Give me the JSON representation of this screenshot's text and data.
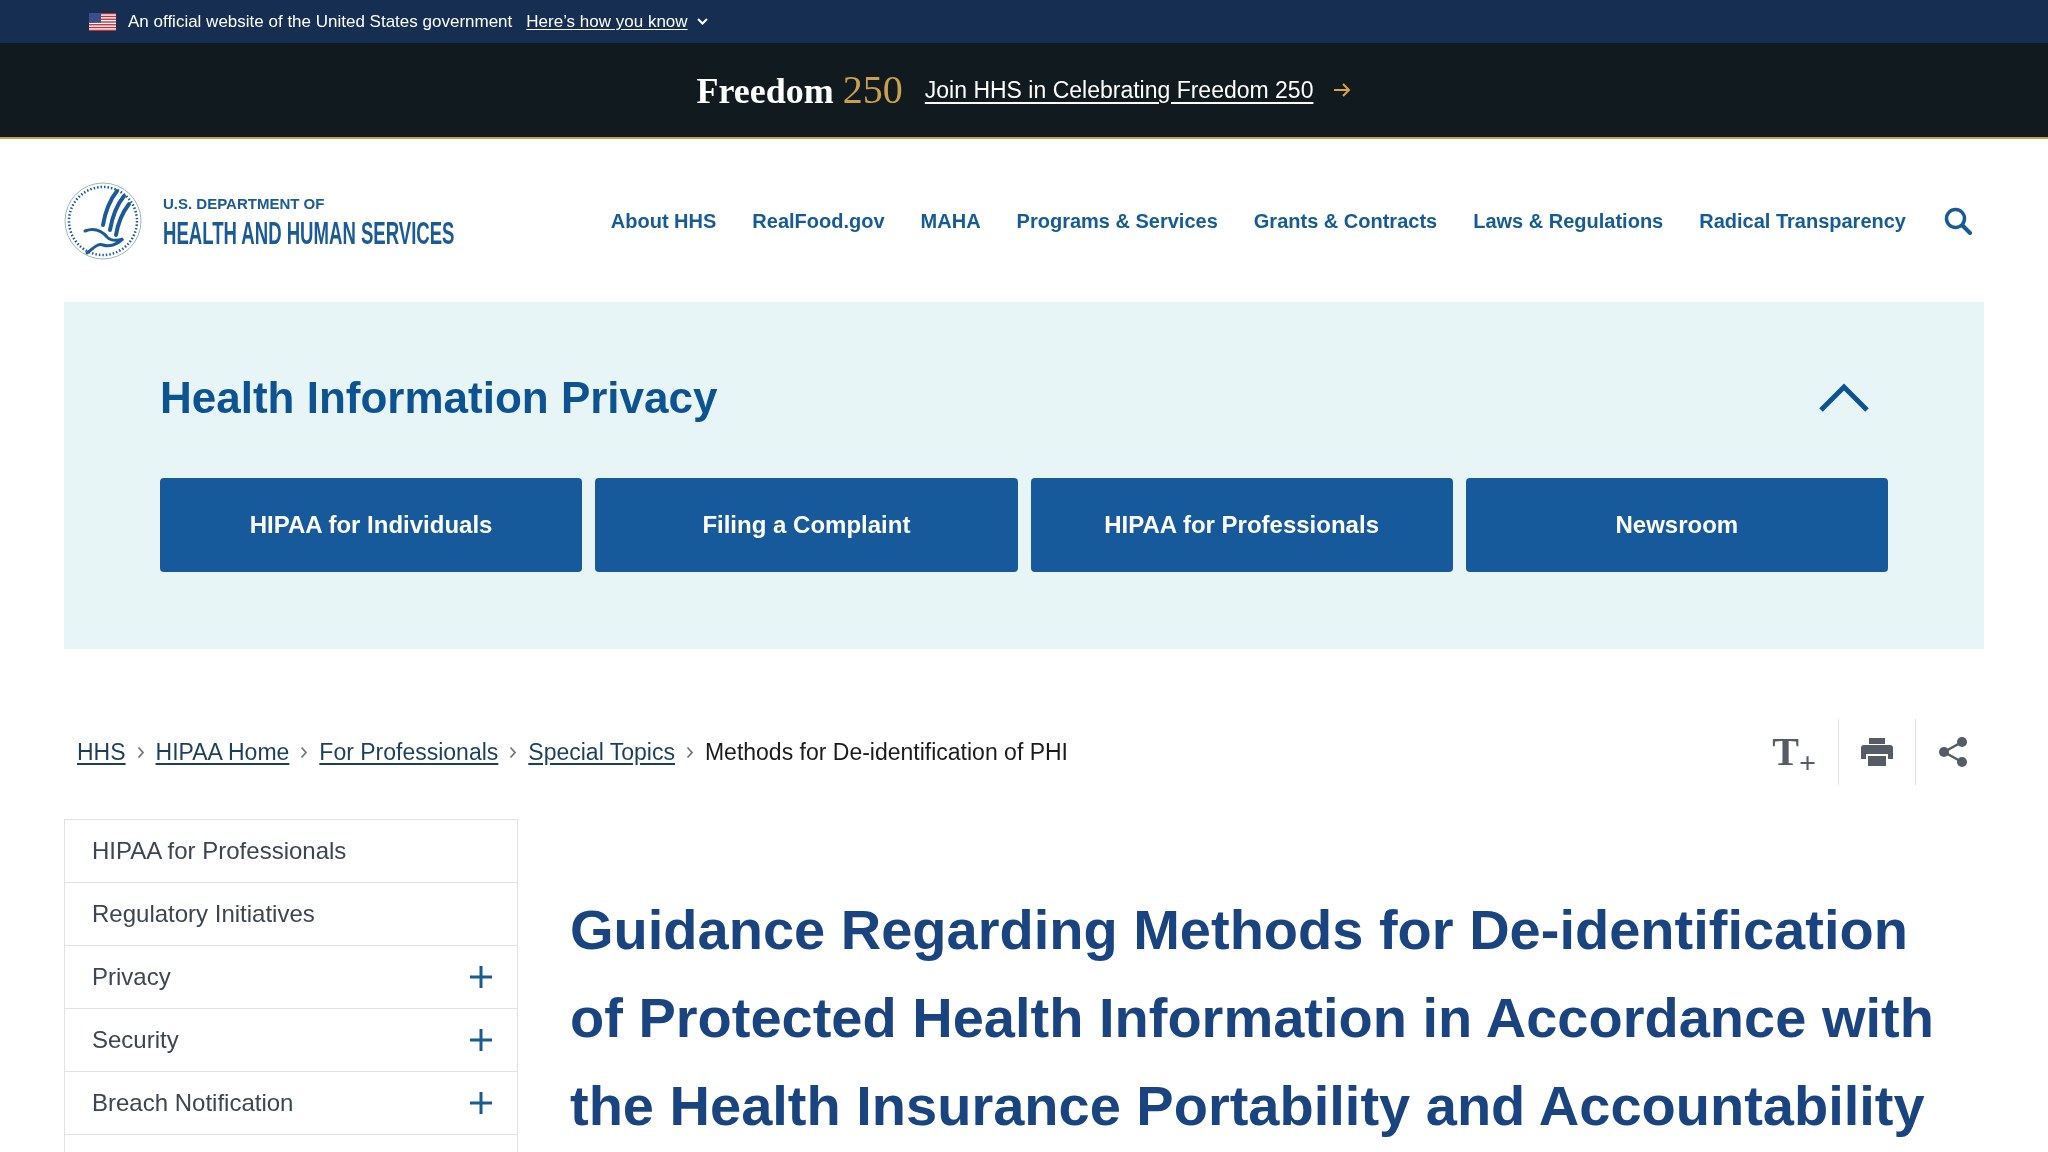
{
  "gov_banner": {
    "text": "An official website of the United States government",
    "link": "Here’s how you know",
    "expanded": false
  },
  "promo_bar": {
    "logo_word": "Freedom",
    "logo_number": "250",
    "link": "Join HHS in Celebrating Freedom 250"
  },
  "header": {
    "agency_line_1": "U.S. DEPARTMENT OF",
    "agency_line_2": "HEALTH AND HUMAN SERVICES",
    "nav": [
      "About HHS",
      "RealFood.gov",
      "MAHA",
      "Programs & Services",
      "Grants & Contracts",
      "Laws & Regulations",
      "Radical Transparency"
    ]
  },
  "section": {
    "title": "Health Information Privacy",
    "expanded": true,
    "buttons": [
      "HIPAA for Individuals",
      "Filing a Complaint",
      "HIPAA for Professionals",
      "Newsroom"
    ]
  },
  "breadcrumb": {
    "links": [
      "HHS",
      "HIPAA Home",
      "For Professionals",
      "Special Topics"
    ],
    "current": "Methods for De-identification of PHI"
  },
  "page_tools": [
    {
      "kind": "text_size",
      "label": "T$_{+}$"
    },
    {
      "kind": "print"
    },
    {
      "kind": "share"
    }
  ],
  "sidebar": {
    "items": [
      {
        "label": "HIPAA for Professionals",
        "kind": "link"
      },
      {
        "label": "Regulatory Initiatives",
        "kind": "link"
      },
      {
        "label": "Privacy",
        "kind": "expandable"
      },
      {
        "label": "Security",
        "kind": "expandable"
      },
      {
        "label": "Breach Notification",
        "kind": "expandable"
      }
    ]
  },
  "page_title": "Guidance Regarding Methods for De-identification of Protected Health Information in Accordance with the Health Insurance Portability and Accountability"
}
